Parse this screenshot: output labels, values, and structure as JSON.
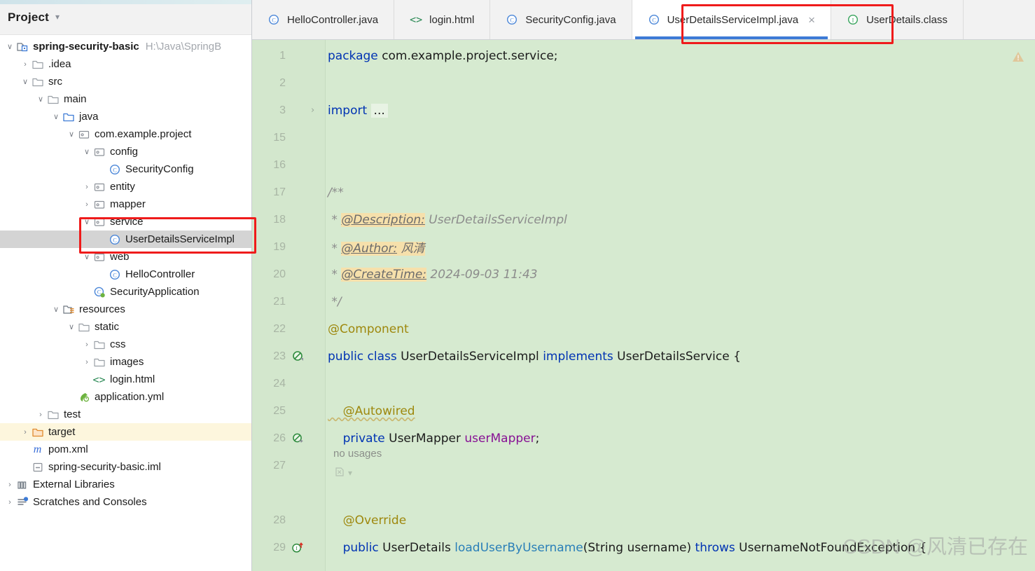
{
  "project_panel": {
    "title": "Project",
    "chevron_icon": "chevron-down-icon",
    "tree": [
      {
        "depth": 0,
        "arrow": "down",
        "icon": "module-icon",
        "label": "spring-security-basic",
        "bold": true,
        "sub": "H:\\Java\\SpringB",
        "state": "normal"
      },
      {
        "depth": 1,
        "arrow": "right",
        "icon": "folder-icon",
        "label": ".idea",
        "bold": false,
        "sub": "",
        "state": "normal"
      },
      {
        "depth": 1,
        "arrow": "down",
        "icon": "folder-icon",
        "label": "src",
        "bold": false,
        "sub": "",
        "state": "normal"
      },
      {
        "depth": 2,
        "arrow": "down",
        "icon": "folder-icon",
        "label": "main",
        "bold": false,
        "sub": "",
        "state": "normal"
      },
      {
        "depth": 3,
        "arrow": "down",
        "icon": "source-root-icon",
        "label": "java",
        "bold": false,
        "sub": "",
        "state": "normal"
      },
      {
        "depth": 4,
        "arrow": "down",
        "icon": "package-icon",
        "label": "com.example.project",
        "bold": false,
        "sub": "",
        "state": "normal"
      },
      {
        "depth": 5,
        "arrow": "down",
        "icon": "package-icon",
        "label": "config",
        "bold": false,
        "sub": "",
        "state": "normal"
      },
      {
        "depth": 6,
        "arrow": "none",
        "icon": "java-class-icon",
        "label": "SecurityConfig",
        "bold": false,
        "sub": "",
        "state": "normal"
      },
      {
        "depth": 5,
        "arrow": "right",
        "icon": "package-icon",
        "label": "entity",
        "bold": false,
        "sub": "",
        "state": "normal"
      },
      {
        "depth": 5,
        "arrow": "right",
        "icon": "package-icon",
        "label": "mapper",
        "bold": false,
        "sub": "",
        "state": "normal"
      },
      {
        "depth": 5,
        "arrow": "down",
        "icon": "package-icon",
        "label": "service",
        "bold": false,
        "sub": "",
        "state": "normal"
      },
      {
        "depth": 6,
        "arrow": "none",
        "icon": "java-class-icon",
        "label": "UserDetailsServiceImpl",
        "bold": false,
        "sub": "",
        "state": "selected"
      },
      {
        "depth": 5,
        "arrow": "down",
        "icon": "package-icon",
        "label": "web",
        "bold": false,
        "sub": "",
        "state": "normal"
      },
      {
        "depth": 6,
        "arrow": "none",
        "icon": "java-class-icon",
        "label": "HelloController",
        "bold": false,
        "sub": "",
        "state": "normal"
      },
      {
        "depth": 5,
        "arrow": "none",
        "icon": "spring-boot-icon",
        "label": "SecurityApplication",
        "bold": false,
        "sub": "",
        "state": "normal"
      },
      {
        "depth": 3,
        "arrow": "down",
        "icon": "resource-root-icon",
        "label": "resources",
        "bold": false,
        "sub": "",
        "state": "normal"
      },
      {
        "depth": 4,
        "arrow": "down",
        "icon": "folder-icon",
        "label": "static",
        "bold": false,
        "sub": "",
        "state": "normal"
      },
      {
        "depth": 5,
        "arrow": "right",
        "icon": "folder-icon",
        "label": "css",
        "bold": false,
        "sub": "",
        "state": "normal"
      },
      {
        "depth": 5,
        "arrow": "right",
        "icon": "folder-icon",
        "label": "images",
        "bold": false,
        "sub": "",
        "state": "normal"
      },
      {
        "depth": 5,
        "arrow": "none",
        "icon": "html-file-icon",
        "label": "login.html",
        "bold": false,
        "sub": "",
        "state": "normal"
      },
      {
        "depth": 4,
        "arrow": "none",
        "icon": "yml-file-icon",
        "label": "application.yml",
        "bold": false,
        "sub": "",
        "state": "normal"
      },
      {
        "depth": 2,
        "arrow": "right",
        "icon": "folder-icon",
        "label": "test",
        "bold": false,
        "sub": "",
        "state": "normal"
      },
      {
        "depth": 1,
        "arrow": "right",
        "icon": "target-folder-icon",
        "label": "target",
        "bold": false,
        "sub": "",
        "state": "yellow"
      },
      {
        "depth": 1,
        "arrow": "none",
        "icon": "maven-icon",
        "label": "pom.xml",
        "bold": false,
        "sub": "",
        "state": "normal"
      },
      {
        "depth": 1,
        "arrow": "none",
        "icon": "iml-file-icon",
        "label": "spring-security-basic.iml",
        "bold": false,
        "sub": "",
        "state": "normal"
      },
      {
        "depth": 0,
        "arrow": "right",
        "icon": "libraries-icon",
        "label": "External Libraries",
        "bold": false,
        "sub": "",
        "state": "normal"
      },
      {
        "depth": 0,
        "arrow": "right",
        "icon": "scratches-icon",
        "label": "Scratches and Consoles",
        "bold": false,
        "sub": "",
        "state": "normal"
      }
    ]
  },
  "tabs": [
    {
      "label": "HelloController.java",
      "icon": "java-class-icon",
      "active": false,
      "closable": false
    },
    {
      "label": "login.html",
      "icon": "html-file-icon",
      "active": false,
      "closable": false
    },
    {
      "label": "SecurityConfig.java",
      "icon": "java-class-icon",
      "active": false,
      "closable": false
    },
    {
      "label": "UserDetailsServiceImpl.java",
      "icon": "java-class-icon",
      "active": true,
      "closable": true,
      "close_label": "×"
    },
    {
      "label": "UserDetails.class",
      "icon": "java-interface-icon",
      "active": false,
      "closable": false
    }
  ],
  "editor": {
    "warning_icon": "warning-triangle-icon",
    "inlay_no_usages": "no usages",
    "inlay_icon": "inlay-hint-icon",
    "inlay_chevron": "chevron-down-icon",
    "lines": [
      {
        "num": "1",
        "gutter": "",
        "fold": "",
        "segments": [
          {
            "t": "package ",
            "c": "kw"
          },
          {
            "t": "com.example.project.service;",
            "c": "plain"
          }
        ]
      },
      {
        "num": "2",
        "gutter": "",
        "fold": "",
        "segments": []
      },
      {
        "num": "3",
        "gutter": "",
        "fold": ">",
        "segments": [
          {
            "t": "import ",
            "c": "kw"
          },
          {
            "t": "...",
            "c": "import-dots"
          }
        ]
      },
      {
        "num": "15",
        "gutter": "",
        "fold": "",
        "segments": []
      },
      {
        "num": "16",
        "gutter": "",
        "fold": "",
        "segments": []
      },
      {
        "num": "17",
        "gutter": "",
        "fold": "",
        "segments": [
          {
            "t": "/**",
            "c": "cmt"
          }
        ]
      },
      {
        "num": "18",
        "gutter": "",
        "fold": "",
        "segments": [
          {
            "t": " * ",
            "c": "cmt"
          },
          {
            "t": "@Description:",
            "c": "cmt-tag"
          },
          {
            "t": " UserDetailsServiceImpl",
            "c": "cmt"
          }
        ]
      },
      {
        "num": "19",
        "gutter": "",
        "fold": "",
        "segments": [
          {
            "t": " * ",
            "c": "cmt"
          },
          {
            "t": "@Author:",
            "c": "cmt-tag"
          },
          {
            "t": " 风清",
            "c": "cmt-hl"
          }
        ]
      },
      {
        "num": "20",
        "gutter": "",
        "fold": "",
        "segments": [
          {
            "t": " * ",
            "c": "cmt"
          },
          {
            "t": "@CreateTime:",
            "c": "cmt-tag"
          },
          {
            "t": " 2024-09-03 11:43",
            "c": "cmt"
          }
        ]
      },
      {
        "num": "21",
        "gutter": "",
        "fold": "",
        "segments": [
          {
            "t": " */",
            "c": "cmt"
          }
        ]
      },
      {
        "num": "22",
        "gutter": "",
        "fold": "",
        "segments": [
          {
            "t": "@Component",
            "c": "anno"
          }
        ]
      },
      {
        "num": "23",
        "gutter": "bean-icon",
        "fold": "",
        "segments": [
          {
            "t": "public class ",
            "c": "kw"
          },
          {
            "t": "UserDetailsServiceImpl ",
            "c": "plain"
          },
          {
            "t": "implements ",
            "c": "kw"
          },
          {
            "t": "UserDetailsService {",
            "c": "plain"
          }
        ]
      },
      {
        "num": "24",
        "gutter": "",
        "fold": "",
        "segments": []
      },
      {
        "num": "25",
        "gutter": "",
        "fold": "",
        "segments": [
          {
            "t": "    @Autowired",
            "c": "anno wavy"
          }
        ]
      },
      {
        "num": "26",
        "gutter": "autowired-icon",
        "fold": "",
        "segments": [
          {
            "t": "    private ",
            "c": "kw"
          },
          {
            "t": "UserMapper ",
            "c": "plain"
          },
          {
            "t": "userMapper",
            "c": "field"
          },
          {
            "t": ";",
            "c": "plain"
          }
        ]
      },
      {
        "num": "27",
        "gutter": "",
        "fold": "",
        "segments": []
      },
      {
        "num": "28",
        "gutter": "",
        "fold": "",
        "segments": [
          {
            "t": "    @Override",
            "c": "anno"
          }
        ]
      },
      {
        "num": "29",
        "gutter": "implements-icon",
        "fold": "",
        "segments": [
          {
            "t": "    public ",
            "c": "kw"
          },
          {
            "t": "UserDetails ",
            "c": "plain"
          },
          {
            "t": "loadUserByUsername",
            "c": "mth"
          },
          {
            "t": "(String username) ",
            "c": "plain"
          },
          {
            "t": "throws ",
            "c": "kw"
          },
          {
            "t": "UsernameNotFoundException {",
            "c": "plain"
          }
        ]
      }
    ]
  },
  "watermark": "CSDN @风清已存在",
  "colors": {
    "editor_bg": "#d6ead0",
    "gutter_bg": "#d3e7cd",
    "tab_active_underline": "#3d7bd6",
    "annotation_red": "#ef1b1b",
    "selection_gray": "#d4d4d4",
    "target_yellow": "#fdf6dd"
  }
}
